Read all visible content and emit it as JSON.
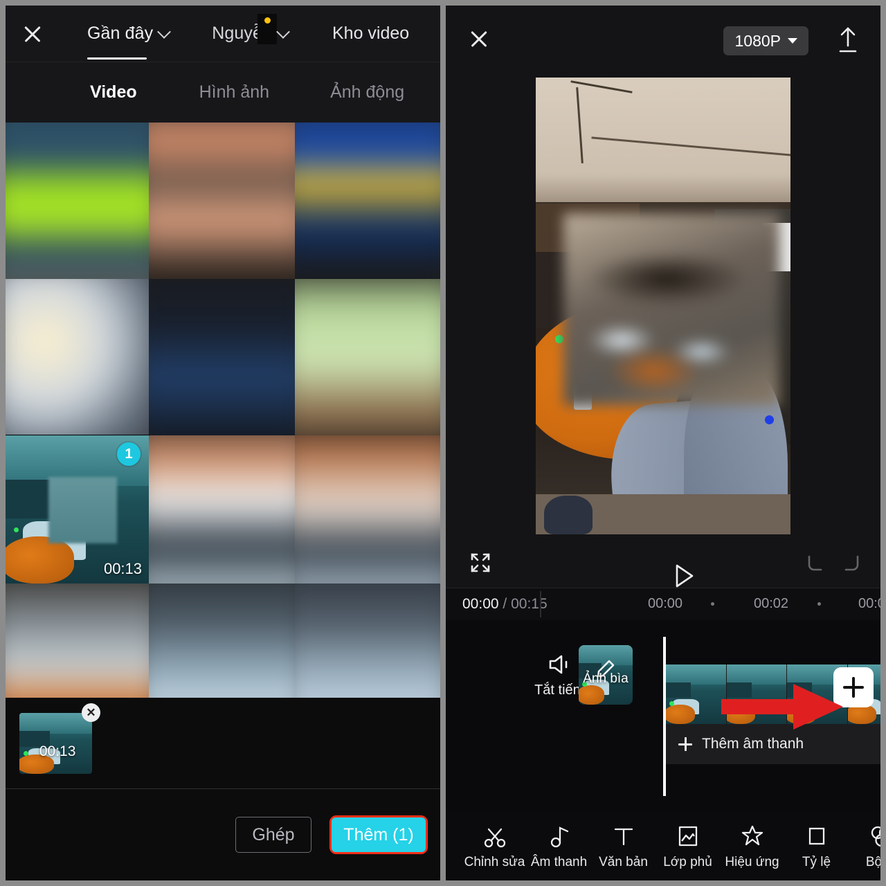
{
  "left_panel": {
    "close_icon": "close-icon",
    "source_tabs": [
      {
        "label": "Gần đây",
        "active": true,
        "has_caret": true
      },
      {
        "label": "Nguyễn",
        "active": false,
        "has_caret": true,
        "redacted": true,
        "dot_color": "#ffc20e"
      },
      {
        "label": "Kho video",
        "active": false,
        "has_caret": false
      }
    ],
    "media_tabs": [
      {
        "label": "Video",
        "active": true
      },
      {
        "label": "Hình ảnh",
        "active": false
      },
      {
        "label": "Ảnh động",
        "active": false
      }
    ],
    "grid": {
      "selected_badge": "1",
      "selected_duration": "00:13"
    },
    "selected_strip": {
      "remove_icon": "close-icon",
      "duration": "00:13"
    },
    "footer": {
      "merge_label": "Ghép",
      "add_label": "Thêm (1)",
      "add_button_color": "#25d2e8",
      "highlight_color": "#ff2d16"
    }
  },
  "right_panel": {
    "close_icon": "close-icon",
    "resolution": "1080P",
    "export_icon": "upload-icon",
    "controls": {
      "fullscreen_icon": "fullscreen-icon",
      "play_icon": "play-icon",
      "undo_icon": "undo-icon",
      "redo_icon": "redo-icon"
    },
    "ruler": {
      "current_time": "00:00",
      "separator": "/",
      "total_time": "00:15",
      "ticks": [
        "00:00",
        "00:02",
        "00:0"
      ]
    },
    "timeline": {
      "mute_label": "Tắt tiếng",
      "mute_icon": "speaker-mute-icon",
      "cover_label": "Ảnh bìa",
      "cover_icon": "pencil-icon",
      "add_clip_icon": "plus-icon",
      "add_audio_label": "Thêm âm thanh",
      "arrow_annotation_color": "#e02020"
    },
    "toolbar": [
      {
        "label": "Chỉnh sửa",
        "icon": "scissors-icon"
      },
      {
        "label": "Âm thanh",
        "icon": "music-note-icon"
      },
      {
        "label": "Văn bản",
        "icon": "text-icon"
      },
      {
        "label": "Lớp phủ",
        "icon": "overlay-image-icon"
      },
      {
        "label": "Hiệu ứng",
        "icon": "star-sparkle-icon"
      },
      {
        "label": "Tỷ lệ",
        "icon": "aspect-ratio-icon"
      },
      {
        "label": "Bộ lọ",
        "icon": "filter-icon"
      }
    ]
  }
}
